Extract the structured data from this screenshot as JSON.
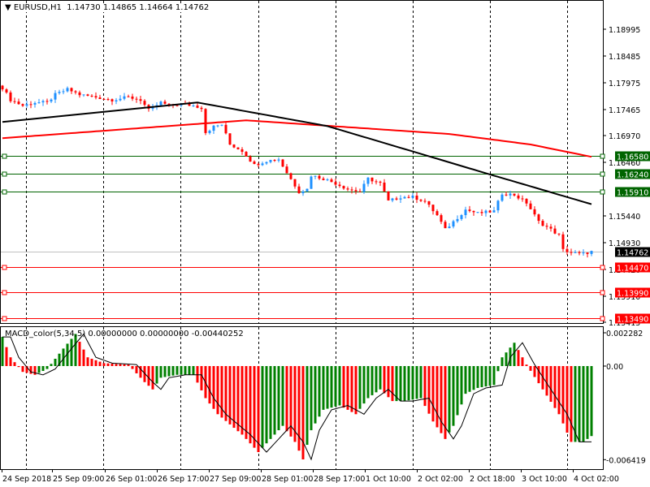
{
  "header": {
    "symbol": "EURUSD,H1",
    "open": "1.14730",
    "high": "1.14865",
    "low": "1.14664",
    "close": "1.14762"
  },
  "macd_header": {
    "name": "MACD_color(5,34,5)",
    "v1": "0.00000000",
    "v2": "0.00000000",
    "v3": "-0.00440252"
  },
  "colors": {
    "bull": "#1e90ff",
    "bear": "#ff0000",
    "ma_fast": "#000000",
    "ma_slow": "#ff0000",
    "support": "#ff0000",
    "resistance": "#006400",
    "macd_up": "#008000",
    "macd_down": "#ff0000"
  },
  "chart_data": [
    {
      "type": "candlestick",
      "title": "EURUSD,H1",
      "ylim": [
        1.1341,
        1.1925
      ],
      "yticks": [
        "1.18995",
        "1.18485",
        "1.17975",
        "1.17465",
        "1.16970",
        "1.16460",
        "1.15440",
        "1.14930",
        "1.14420",
        "1.13910",
        "1.13415"
      ],
      "price_label": "1.14762",
      "levels": [
        {
          "value": 1.1658,
          "label": "1.16580",
          "kind": "resistance"
        },
        {
          "value": 1.1624,
          "label": "1.16240",
          "kind": "resistance"
        },
        {
          "value": 1.1591,
          "label": "1.15910",
          "kind": "resistance"
        },
        {
          "value": 1.1447,
          "label": "1.14470",
          "kind": "support"
        },
        {
          "value": 1.1399,
          "label": "1.13990",
          "kind": "support"
        },
        {
          "value": 1.1349,
          "label": "1.13490",
          "kind": "support"
        }
      ],
      "close_path": [
        [
          0,
          1.1788
        ],
        [
          2,
          1.1765
        ],
        [
          5,
          1.1754
        ],
        [
          8,
          1.176
        ],
        [
          11,
          1.176
        ],
        [
          13,
          1.1775
        ],
        [
          16,
          1.1785
        ],
        [
          19,
          1.1775
        ],
        [
          23,
          1.177
        ],
        [
          27,
          1.1765
        ],
        [
          31,
          1.177
        ],
        [
          34,
          1.1765
        ],
        [
          36,
          1.1745
        ],
        [
          39,
          1.176
        ],
        [
          41,
          1.1754
        ],
        [
          44,
          1.1757
        ],
        [
          47,
          1.1754
        ],
        [
          49,
          1.175
        ],
        [
          50,
          1.1703
        ],
        [
          52,
          1.1714
        ],
        [
          54,
          1.1718
        ],
        [
          56,
          1.168
        ],
        [
          59,
          1.1668
        ],
        [
          62,
          1.1641
        ],
        [
          65,
          1.1649
        ],
        [
          68,
          1.1652
        ],
        [
          70,
          1.1626
        ],
        [
          73,
          1.159
        ],
        [
          75,
          1.1595
        ],
        [
          76,
          1.1621
        ],
        [
          79,
          1.1615
        ],
        [
          82,
          1.1606
        ],
        [
          85,
          1.1595
        ],
        [
          88,
          1.159
        ],
        [
          90,
          1.1615
        ],
        [
          93,
          1.1606
        ],
        [
          95,
          1.1572
        ],
        [
          98,
          1.158
        ],
        [
          101,
          1.158
        ],
        [
          104,
          1.1572
        ],
        [
          107,
          1.1545
        ],
        [
          109,
          1.1518
        ],
        [
          111,
          1.1533
        ],
        [
          114,
          1.1556
        ],
        [
          117,
          1.1549
        ],
        [
          121,
          1.1553
        ],
        [
          123,
          1.1587
        ],
        [
          126,
          1.1584
        ],
        [
          129,
          1.1569
        ],
        [
          132,
          1.1533
        ],
        [
          135,
          1.1518
        ],
        [
          137,
          1.1507
        ],
        [
          138,
          1.1479
        ],
        [
          141,
          1.1473
        ],
        [
          143,
          1.1472
        ],
        [
          145,
          1.1476
        ]
      ],
      "ma_fast": [
        [
          0,
          1.1723
        ],
        [
          48,
          1.176
        ],
        [
          80,
          1.1715
        ],
        [
          120,
          1.1623
        ],
        [
          146,
          1.1564
        ]
      ],
      "ma_slow": [
        [
          0,
          1.1692
        ],
        [
          60,
          1.1726
        ],
        [
          110,
          1.17
        ],
        [
          130,
          1.168
        ],
        [
          146,
          1.1655
        ]
      ],
      "x_labels": [
        "24 Sep 2018",
        "25 Sep 09:00",
        "26 Sep 01:00",
        "26 Sep 17:00",
        "27 Sep 09:00",
        "28 Sep 01:00",
        "28 Sep 17:00",
        "1 Oct 10:00",
        "2 Oct 02:00",
        "2 Oct 18:00",
        "3 Oct 10:00",
        "4 Oct 02:00"
      ]
    },
    {
      "type": "bar",
      "title": "MACD_color(5,34,5)",
      "ylim": [
        -0.006419,
        0.002282
      ],
      "yticks": [
        "0.002282",
        "0.00",
        "-0.006419"
      ],
      "hist_path": [
        [
          0,
          0.002
        ],
        [
          2,
          0.0006
        ],
        [
          5,
          -0.0004
        ],
        [
          8,
          -0.0006
        ],
        [
          11,
          -0.0002
        ],
        [
          15,
          0.0012
        ],
        [
          18,
          0.0022
        ],
        [
          21,
          0.0006
        ],
        [
          25,
          0.0002
        ],
        [
          31,
          0.0001
        ],
        [
          35,
          -0.0011
        ],
        [
          37,
          -0.0016
        ],
        [
          39,
          -0.0008
        ],
        [
          43,
          -0.0006
        ],
        [
          47,
          -0.0006
        ],
        [
          50,
          -0.0022
        ],
        [
          53,
          -0.0033
        ],
        [
          59,
          -0.0047
        ],
        [
          63,
          -0.0059
        ],
        [
          66,
          -0.005
        ],
        [
          69,
          -0.0041
        ],
        [
          72,
          -0.0052
        ],
        [
          74,
          -0.0064
        ],
        [
          76,
          -0.0044
        ],
        [
          79,
          -0.003
        ],
        [
          83,
          -0.0027
        ],
        [
          87,
          -0.0033
        ],
        [
          90,
          -0.0022
        ],
        [
          93,
          -0.0016
        ],
        [
          96,
          -0.0024
        ],
        [
          99,
          -0.0024
        ],
        [
          103,
          -0.0022
        ],
        [
          106,
          -0.0038
        ],
        [
          109,
          -0.005
        ],
        [
          111,
          -0.0041
        ],
        [
          114,
          -0.0019
        ],
        [
          117,
          -0.0015
        ],
        [
          121,
          -0.0013
        ],
        [
          123,
          0.0006
        ],
        [
          126,
          0.0016
        ],
        [
          129,
          0.0001
        ],
        [
          133,
          -0.0016
        ],
        [
          137,
          -0.0033
        ],
        [
          140,
          -0.0052
        ],
        [
          143,
          -0.0052
        ],
        [
          145,
          -0.0048
        ]
      ]
    }
  ]
}
